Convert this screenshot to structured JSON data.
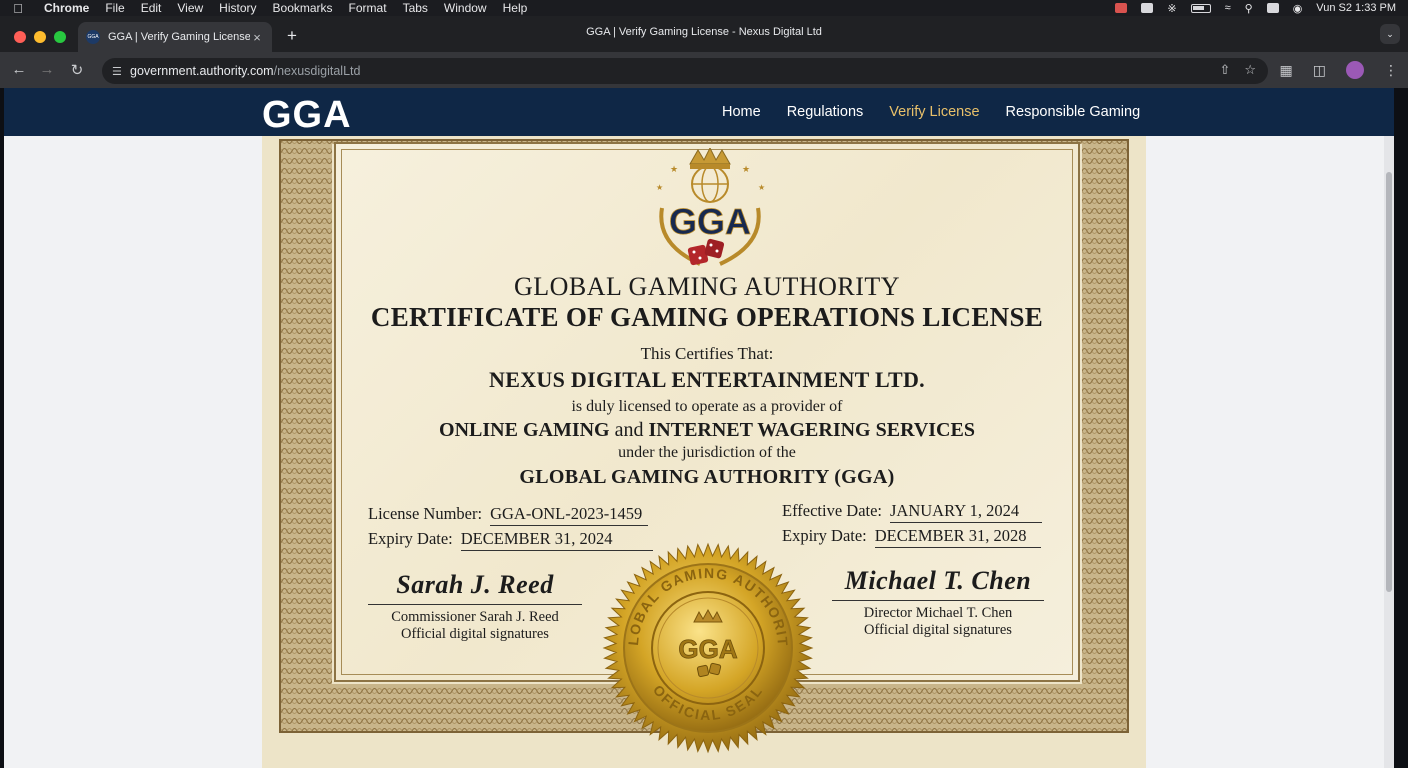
{
  "menubar": {
    "app_name": "Chrome",
    "items": [
      "File",
      "Edit",
      "View",
      "History",
      "Bookmarks",
      "Format",
      "Tabs",
      "Window",
      "Help"
    ],
    "clock": "Vun S2 1:33 PM"
  },
  "browser": {
    "tab_title": "GGA | Verify Gaming License",
    "window_title": "GGA | Verify Gaming License - Nexus Digital Ltd",
    "url_host": "government.authority.com",
    "url_path": "/nexusdigitalLtd"
  },
  "site": {
    "logo": "GGA",
    "nav": [
      "Home",
      "Regulations",
      "Verify License",
      "Responsible Gaming"
    ],
    "active_nav": "Verify License"
  },
  "certificate": {
    "crest_text": "GGA",
    "authority": "GLOBAL GAMING AUTHORITY",
    "title": "CERTIFICATE OF GAMING OPERATIONS LICENSE",
    "certifies": "This Certifies That:",
    "entity": "NEXUS DIGITAL ENTERTAINMENT LTD.",
    "duly": "is duly licensed to operate as a provider of",
    "services_a": "ONLINE GAMING",
    "services_and": "and",
    "services_b": "INTERNET WAGERING SERVICES",
    "under": "under the jurisdiction of the",
    "authority_full": "GLOBAL GAMING AUTHORITY (GGA)",
    "license_label": "License Number:",
    "license_value": "GGA-ONL-2023-1459",
    "expiry_label_left": "Expiry Date:",
    "expiry_value_left": "DECEMBER 31, 2024",
    "effective_label": "Effective Date:",
    "effective_value": "JANUARY 1, 2024",
    "expiry_label_right": "Expiry Date:",
    "expiry_value_right": "DECEMBER 31, 2028",
    "sig_left_script": "Sarah J. Reed",
    "sig_left_title": "Commissioner Sarah J. Reed",
    "sig_left_note": "Official digital signatures",
    "sig_right_script": "Michael T. Chen",
    "sig_right_title": "Director Michael T. Chen",
    "sig_right_note": "Official digital signatures",
    "seal_top": "GLOBAL GAMING AUTHORITY",
    "seal_center": "GGA",
    "seal_bottom": "OFFICIAL SEAL"
  },
  "colors": {
    "site_header": "#0f2746",
    "nav_active": "#e8c06a",
    "certificate_paper": "#f3ecd6",
    "seal_gold": "#d4a526"
  }
}
